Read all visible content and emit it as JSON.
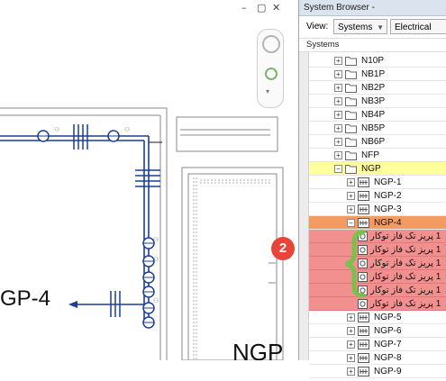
{
  "canvas": {
    "window_controls": [
      "–",
      "▢",
      "✕"
    ],
    "tag_gp4": "GP-4",
    "tag_ngp": "NGP"
  },
  "browser": {
    "title": "System Browser -",
    "view_label": "View:",
    "view_value": "Systems",
    "filter_value": "Electrical",
    "tree_header": "Systems",
    "rows": [
      {
        "label": "N10P",
        "kind": "folder",
        "state": "normal"
      },
      {
        "label": "NB1P",
        "kind": "folder",
        "state": "normal"
      },
      {
        "label": "NB2P",
        "kind": "folder",
        "state": "normal"
      },
      {
        "label": "NB3P",
        "kind": "folder",
        "state": "normal"
      },
      {
        "label": "NB4P",
        "kind": "folder",
        "state": "normal"
      },
      {
        "label": "NB5P",
        "kind": "folder",
        "state": "normal"
      },
      {
        "label": "NB6P",
        "kind": "folder",
        "state": "normal"
      },
      {
        "label": "NFP",
        "kind": "folder",
        "state": "normal"
      },
      {
        "label": "NGP",
        "kind": "folder",
        "state": "selected-yellow"
      },
      {
        "label": "NGP-1",
        "kind": "circuit",
        "state": "normal"
      },
      {
        "label": "NGP-2",
        "kind": "circuit",
        "state": "normal"
      },
      {
        "label": "NGP-3",
        "kind": "circuit",
        "state": "normal"
      },
      {
        "label": "NGP-4",
        "kind": "circuit",
        "state": "selected-orange"
      },
      {
        "label": "1 پریز تک فاز توکار",
        "kind": "device",
        "state": "highlight-red"
      },
      {
        "label": "1 پریز تک فاز توکار",
        "kind": "device",
        "state": "highlight-red"
      },
      {
        "label": "1 پریز تک فاز توکار",
        "kind": "device",
        "state": "highlight-red"
      },
      {
        "label": "1 پریز تک فاز توکار",
        "kind": "device",
        "state": "highlight-red"
      },
      {
        "label": "1 پریز تک فاز توکار",
        "kind": "device",
        "state": "highlight-red"
      },
      {
        "label": "1 پریز تک فاز توکار",
        "kind": "device",
        "state": "highlight-red"
      },
      {
        "label": "NGP-5",
        "kind": "circuit",
        "state": "normal"
      },
      {
        "label": "NGP-6",
        "kind": "circuit",
        "state": "normal"
      },
      {
        "label": "NGP-7",
        "kind": "circuit",
        "state": "normal"
      },
      {
        "label": "NGP-8",
        "kind": "circuit",
        "state": "normal"
      },
      {
        "label": "NGP-9",
        "kind": "circuit",
        "state": "normal"
      }
    ]
  },
  "annotation": {
    "badge_number": "2",
    "colors": {
      "badge": "#e8443a",
      "arrow": "#e8443a",
      "brace": "#79c24a"
    }
  }
}
